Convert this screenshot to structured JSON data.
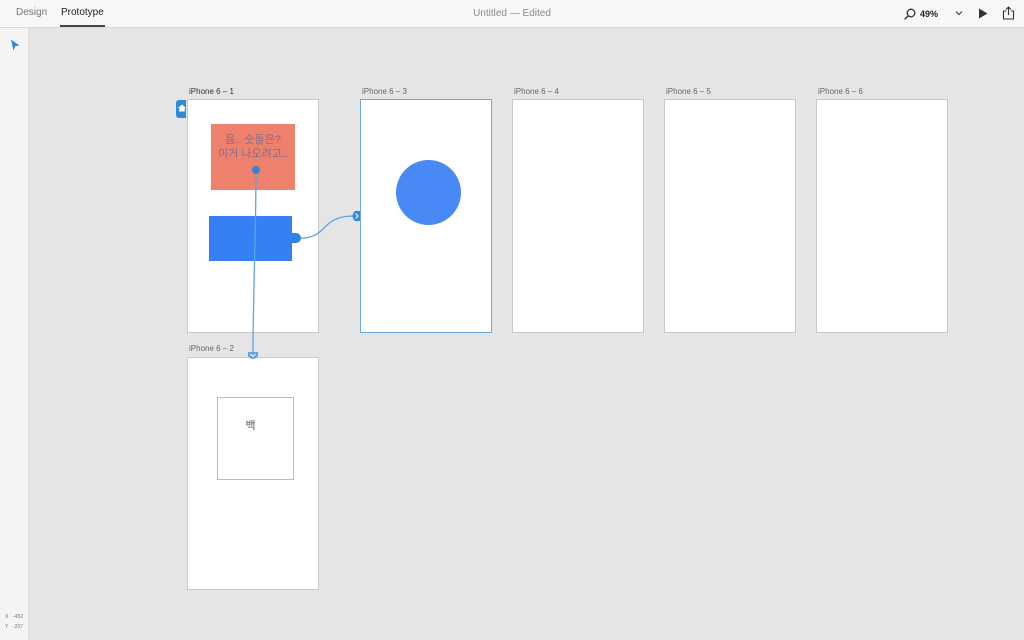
{
  "topbar": {
    "tabs": [
      {
        "label": "Design",
        "active": false
      },
      {
        "label": "Prototype",
        "active": true
      }
    ],
    "title": "Untitled — Edited",
    "zoom": "49%",
    "icons": {
      "zoom": "magnifier-icon",
      "chevron": "chevron-down-icon",
      "play": "play-icon",
      "share": "share-icon"
    }
  },
  "sidebar": {
    "tool_icon": "select-arrow-icon",
    "coords": {
      "x_label": "X",
      "x_value": "-452",
      "y_label": "Y",
      "y_value": "-207"
    }
  },
  "artboards": [
    {
      "name": "iPhone 6 – 1",
      "home": true
    },
    {
      "name": "iPhone 6 – 2"
    },
    {
      "name": "iPhone 6 – 3",
      "selected": true
    },
    {
      "name": "iPhone 6 – 4"
    },
    {
      "name": "iPhone 6 – 5"
    },
    {
      "name": "iPhone 6 – 6"
    }
  ],
  "artboard1": {
    "red_text_line1": "음.. 숫돌은?",
    "red_text_line2": "이거 나오려고.."
  },
  "artboard2": {
    "box_text": "백"
  },
  "colors": {
    "accent": "#2f8ad8",
    "wire": "#5da3e0",
    "red": "#f0806e",
    "blue": "#3580f4",
    "circle": "#4989f5"
  }
}
